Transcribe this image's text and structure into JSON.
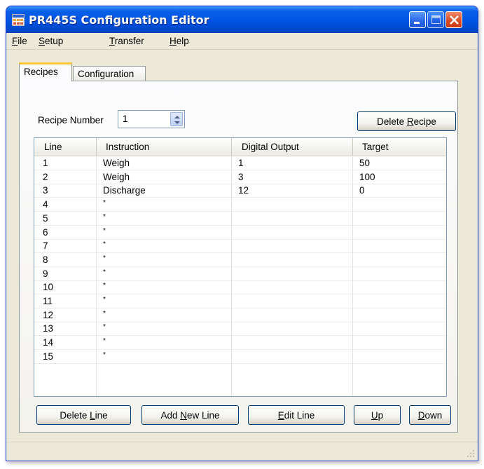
{
  "window": {
    "title": "PR445S Configuration Editor"
  },
  "menu": [
    {
      "label": "File",
      "mnemonic": "F",
      "rest": "ile"
    },
    {
      "label": "Setup",
      "mnemonic": "S",
      "rest": "etup"
    },
    {
      "label": "Transfer",
      "mnemonic": "T",
      "rest": "ransfer"
    },
    {
      "label": "Help",
      "mnemonic": "H",
      "rest": "elp"
    }
  ],
  "tabs": {
    "recipes": "Recipes",
    "configuration": "Configuration",
    "active": "Recipes"
  },
  "recipe": {
    "label": "Recipe Number",
    "value": "1"
  },
  "buttons": {
    "delete_recipe": {
      "pre": "Delete ",
      "mnemonic": "R",
      "post": "ecipe"
    },
    "delete_line": {
      "pre": "Delete ",
      "mnemonic": "L",
      "post": "ine"
    },
    "add_new_line": {
      "pre": "Add ",
      "mnemonic": "N",
      "post": "ew Line"
    },
    "edit_line": {
      "pre": "",
      "mnemonic": "E",
      "post": "dit Line"
    },
    "up": {
      "pre": "",
      "mnemonic": "U",
      "post": "p"
    },
    "down": {
      "pre": "",
      "mnemonic": "D",
      "post": "own"
    }
  },
  "grid": {
    "columns": [
      "Line",
      "Instruction",
      "Digital Output",
      "Target"
    ],
    "rows": [
      {
        "line": "1",
        "instruction": "Weigh",
        "digital_output": "1",
        "target": "50"
      },
      {
        "line": "2",
        "instruction": "Weigh",
        "digital_output": "3",
        "target": "100"
      },
      {
        "line": "3",
        "instruction": "Discharge",
        "digital_output": "12",
        "target": "0"
      },
      {
        "line": "4",
        "instruction": "*",
        "digital_output": "",
        "target": ""
      },
      {
        "line": "5",
        "instruction": "*",
        "digital_output": "",
        "target": ""
      },
      {
        "line": "6",
        "instruction": "*",
        "digital_output": "",
        "target": ""
      },
      {
        "line": "7",
        "instruction": "*",
        "digital_output": "",
        "target": ""
      },
      {
        "line": "8",
        "instruction": "*",
        "digital_output": "",
        "target": ""
      },
      {
        "line": "9",
        "instruction": "*",
        "digital_output": "",
        "target": ""
      },
      {
        "line": "10",
        "instruction": "*",
        "digital_output": "",
        "target": ""
      },
      {
        "line": "11",
        "instruction": "*",
        "digital_output": "",
        "target": ""
      },
      {
        "line": "12",
        "instruction": "*",
        "digital_output": "",
        "target": ""
      },
      {
        "line": "13",
        "instruction": "*",
        "digital_output": "",
        "target": ""
      },
      {
        "line": "14",
        "instruction": "*",
        "digital_output": "",
        "target": ""
      },
      {
        "line": "15",
        "instruction": "*",
        "digital_output": "",
        "target": ""
      }
    ]
  },
  "colors": {
    "titlebar": "#0054e3",
    "tab_highlight": "#ffc83c",
    "window_face": "#ece9d8",
    "close_button": "#d94a21"
  },
  "icons": {
    "app": "app-grid-icon",
    "minimize": "minimize-icon",
    "maximize": "maximize-icon",
    "close": "close-icon",
    "spin": "spin-updown-icon",
    "resize": "resize-grip-icon"
  }
}
